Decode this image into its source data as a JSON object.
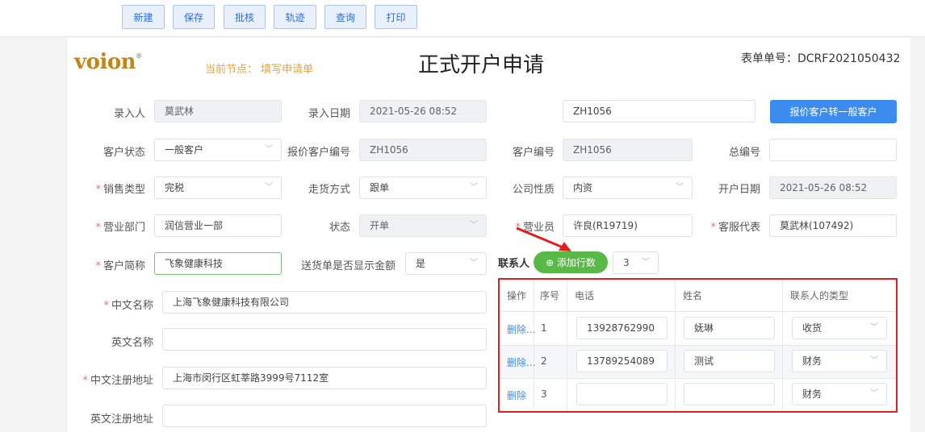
{
  "toolbar": {
    "new_label": "新建",
    "save_label": "保存",
    "approve_label": "批核",
    "track_label": "轨迹",
    "query_label": "查询",
    "print_label": "打印"
  },
  "header": {
    "logo_text": "voion",
    "logo_mark": "®",
    "node_label": "当前节点： 填写申请单",
    "title": "正式开户申请",
    "form_no": "表单单号：DCRF2021050432"
  },
  "form": {
    "entry_person_label": "录入人",
    "entry_person_value": "莫武林",
    "entry_date_label": "录入日期",
    "entry_date_value": "2021-05-26 08:52",
    "quote_code_value": "ZH1056",
    "convert_button": "报价客户转一般客户",
    "customer_status_label": "客户状态",
    "customer_status_value": "一般客户",
    "quote_customer_no_label": "报价客户编号",
    "quote_customer_no_value": "ZH1056",
    "customer_no_label": "客户编号",
    "customer_no_value": "ZH1056",
    "total_no_label": "总编号",
    "total_no_value": "",
    "sales_type_label": "销售类型",
    "sales_type_value": "完税",
    "shipping_method_label": "走货方式",
    "shipping_method_value": "跟单",
    "company_nature_label": "公司性质",
    "company_nature_value": "内资",
    "open_date_label": "开户日期",
    "open_date_value": "2021-05-26 08:52",
    "business_dept_label": "营业部门",
    "business_dept_value": "润信营业一部",
    "status_label": "状态",
    "status_value": "开单",
    "salesperson_label": "营业员",
    "salesperson_value": "许良(R19719)",
    "cs_rep_label": "客服代表",
    "cs_rep_value": "莫武林(107492)",
    "short_name_label": "客户简称",
    "short_name_value": "飞象健康科技",
    "show_amount_label": "送货单是否显示金额",
    "show_amount_value": "是",
    "cn_name_label": "中文名称",
    "cn_name_value": "上海飞象健康科技有限公司",
    "en_name_label": "英文名称",
    "en_name_value": "",
    "cn_address_label": "中文注册地址",
    "cn_address_value": "上海市闵行区虹莘路3999号7112室",
    "en_address_label": "英文注册地址",
    "en_address_value": ""
  },
  "contacts": {
    "label": "联系人",
    "add_rows_button": "⊕ 添加行数",
    "row_count": "3",
    "headers": [
      "操作",
      "序号",
      "电话",
      "姓名",
      "联系人的类型"
    ],
    "rows": [
      {
        "action": "删除...",
        "seq": "1",
        "phone": "13928762990",
        "name": "妩琳",
        "type": "收货"
      },
      {
        "action": "删除...",
        "seq": "2",
        "phone": "13789254089",
        "name": "测试",
        "type": "财务"
      },
      {
        "action": "删除",
        "seq": "3",
        "phone": "",
        "name": "",
        "type": "财务"
      }
    ]
  },
  "colors": {
    "accent": "#3c8cf0",
    "add_button": "#58b947",
    "required": "#f56c6c",
    "highlight_border": "#e02020",
    "logo": "#c4841d",
    "node_text": "#e6a23c"
  }
}
